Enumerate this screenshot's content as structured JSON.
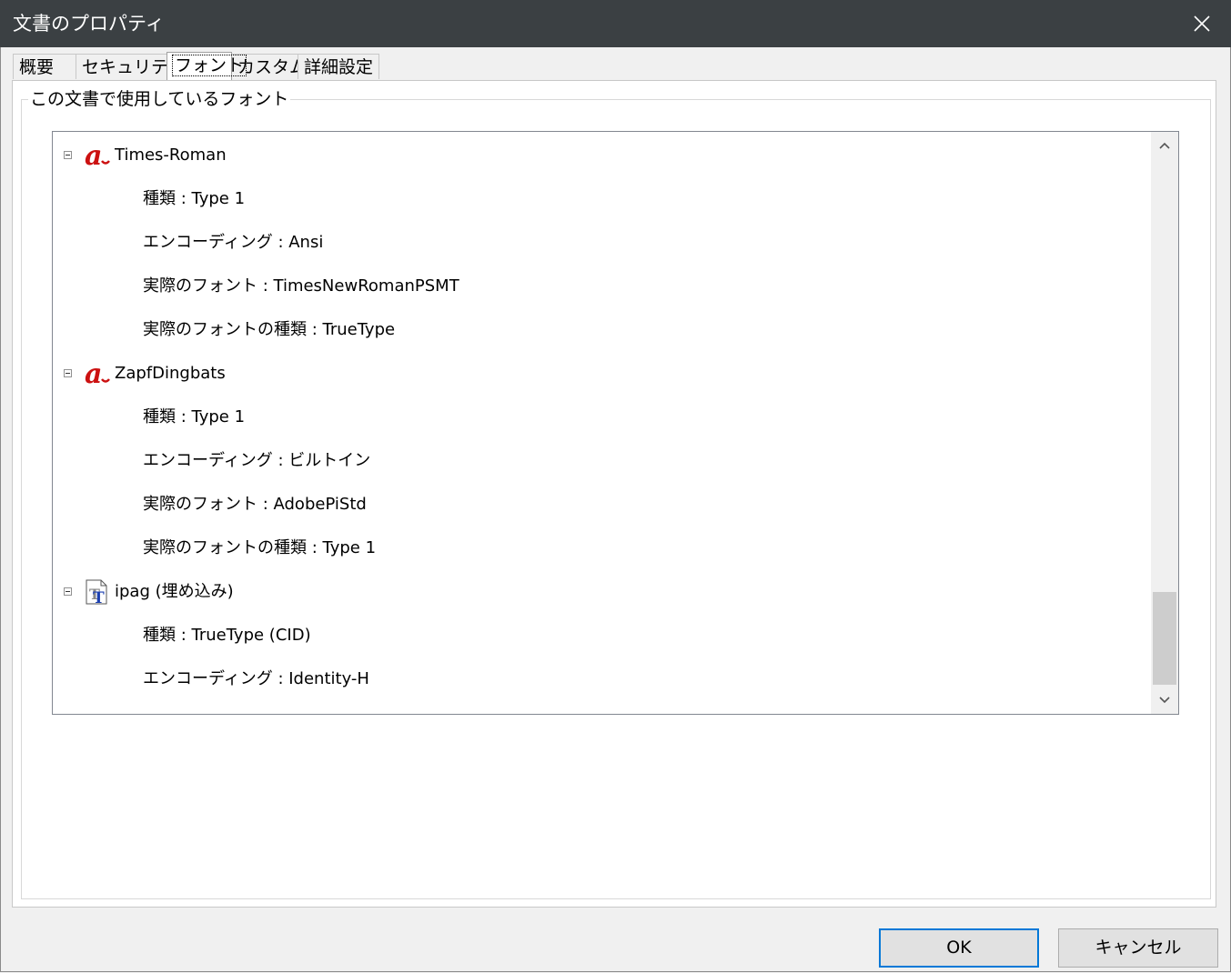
{
  "window": {
    "title": "文書のプロパティ"
  },
  "tabs": [
    {
      "label": "概要",
      "active": false
    },
    {
      "label": "セキュリティ",
      "active": false
    },
    {
      "label": "フォント",
      "active": true
    },
    {
      "label": "カスタム",
      "active": false
    },
    {
      "label": "詳細設定",
      "active": false
    }
  ],
  "fonts_group": {
    "label": "この文書で使用しているフォント"
  },
  "tree": [
    {
      "name": "Times-Roman",
      "icon": "type1-font-icon",
      "expanded": true,
      "details": [
        "種類 : Type 1",
        "エンコーディング : Ansi",
        "実際のフォント : TimesNewRomanPSMT",
        "実際のフォントの種類 : TrueType"
      ]
    },
    {
      "name": "ZapfDingbats",
      "icon": "type1-font-icon",
      "expanded": true,
      "details": [
        "種類 : Type 1",
        "エンコーディング : ビルトイン",
        "実際のフォント : AdobePiStd",
        "実際のフォントの種類 : Type 1"
      ]
    },
    {
      "name": "ipag (埋め込み)",
      "icon": "truetype-font-icon",
      "expanded": true,
      "details": [
        "種類 : TrueType (CID)",
        "エンコーディング : Identity-H"
      ]
    }
  ],
  "buttons": {
    "ok": "OK",
    "cancel": "キャンセル"
  },
  "colors": {
    "titlebar": "#3b4043",
    "accent": "#0078d7",
    "type1_icon": "#cc1111",
    "truetype_icon": "#1b3fb0"
  }
}
